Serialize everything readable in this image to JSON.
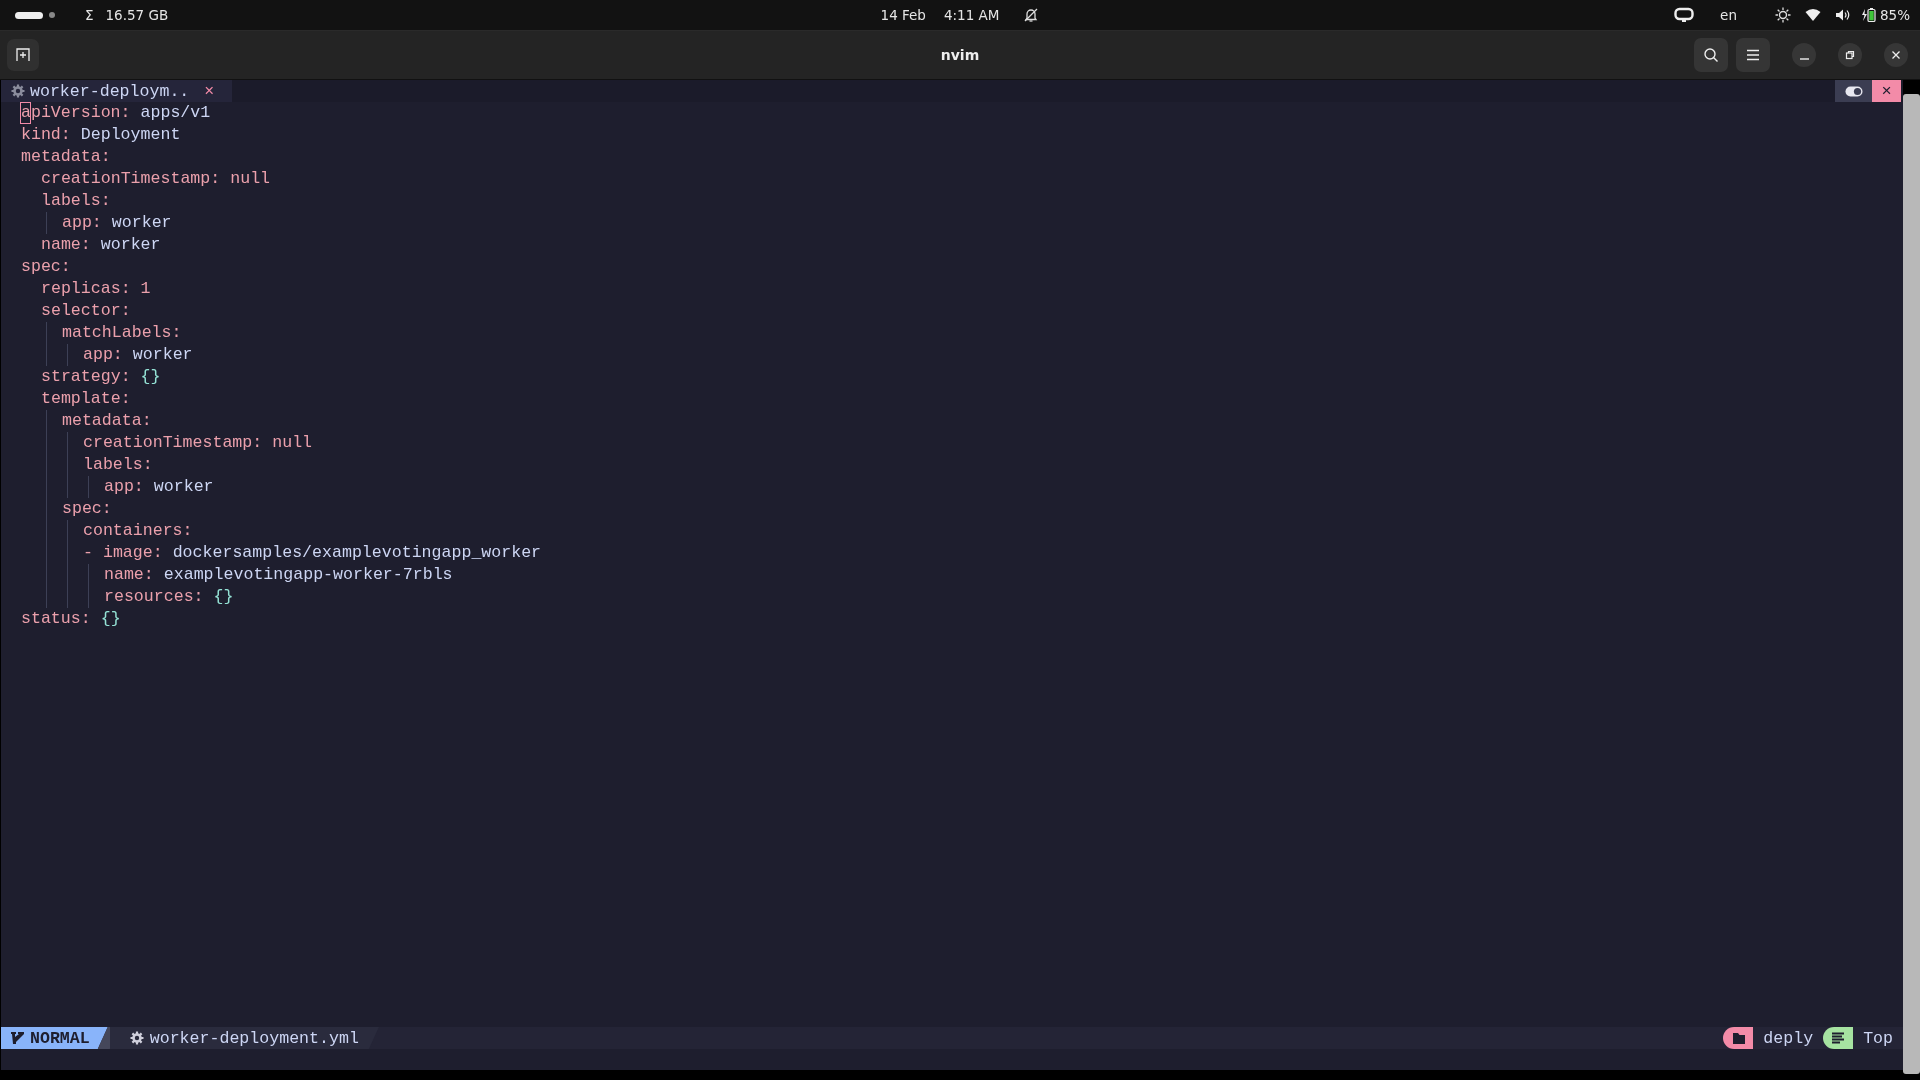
{
  "top_bar": {
    "workspaces": [
      {
        "selected": true
      },
      {
        "selected": false
      }
    ],
    "memory_symbol": "Σ",
    "memory": "16.57 GB",
    "date": "14 Feb",
    "time": "4:11 AM",
    "language": "en",
    "battery": "85%"
  },
  "header_bar": {
    "title": "nvim"
  },
  "tabline": {
    "tabs": [
      {
        "label": "worker-deploym..",
        "close": "×",
        "selected": true
      }
    ],
    "close": "×"
  },
  "buffer": [
    {
      "key": "apiVersion:",
      "value": "apps/v1",
      "kind": "string",
      "cursor": true
    },
    {
      "key": "kind:",
      "value": "Deployment",
      "kind": "string"
    },
    {
      "key": "metadata:",
      "children": [
        {
          "key": "creationTimestamp:",
          "value": "null",
          "kind": "null"
        },
        {
          "key": "labels:",
          "children": [
            {
              "key": "app:",
              "value": "worker",
              "kind": "string"
            }
          ]
        },
        {
          "key": "name:",
          "value": "worker",
          "kind": "string"
        }
      ]
    },
    {
      "key": "spec:",
      "children": [
        {
          "key": "replicas:",
          "value": "1",
          "kind": "number"
        },
        {
          "key": "selector:",
          "children": [
            {
              "key": "matchLabels:",
              "children": [
                {
                  "key": "app:",
                  "value": "worker",
                  "kind": "string"
                }
              ]
            }
          ]
        },
        {
          "key": "strategy:",
          "value": "{}",
          "kind": "map"
        },
        {
          "key": "template:",
          "children": [
            {
              "key": "metadata:",
              "children": [
                {
                  "key": "creationTimestamp:",
                  "value": "null",
                  "kind": "null"
                },
                {
                  "key": "labels:",
                  "children": [
                    {
                      "key": "app:",
                      "value": "worker",
                      "kind": "string"
                    }
                  ]
                }
              ]
            },
            {
              "key": "spec:",
              "children": [
                {
                  "key": "containers:",
                  "children": [
                    {
                      "marker": "-",
                      "children": [
                        {
                          "key": "image:",
                          "value": "dockersamples/examplevotingapp_worker",
                          "kind": "string"
                        },
                        {
                          "key": "name:",
                          "value": "examplevotingapp-worker-7rbls",
                          "kind": "string"
                        },
                        {
                          "key": "resources:",
                          "value": "{}",
                          "kind": "map"
                        }
                      ]
                    }
                  ]
                }
              ]
            }
          ]
        }
      ]
    },
    {
      "key": "status:",
      "value": "{}",
      "kind": "map"
    }
  ],
  "statusline": {
    "mode": "NORMAL",
    "file": "worker-deployment.yml",
    "folder": "deply",
    "position": "Top"
  }
}
